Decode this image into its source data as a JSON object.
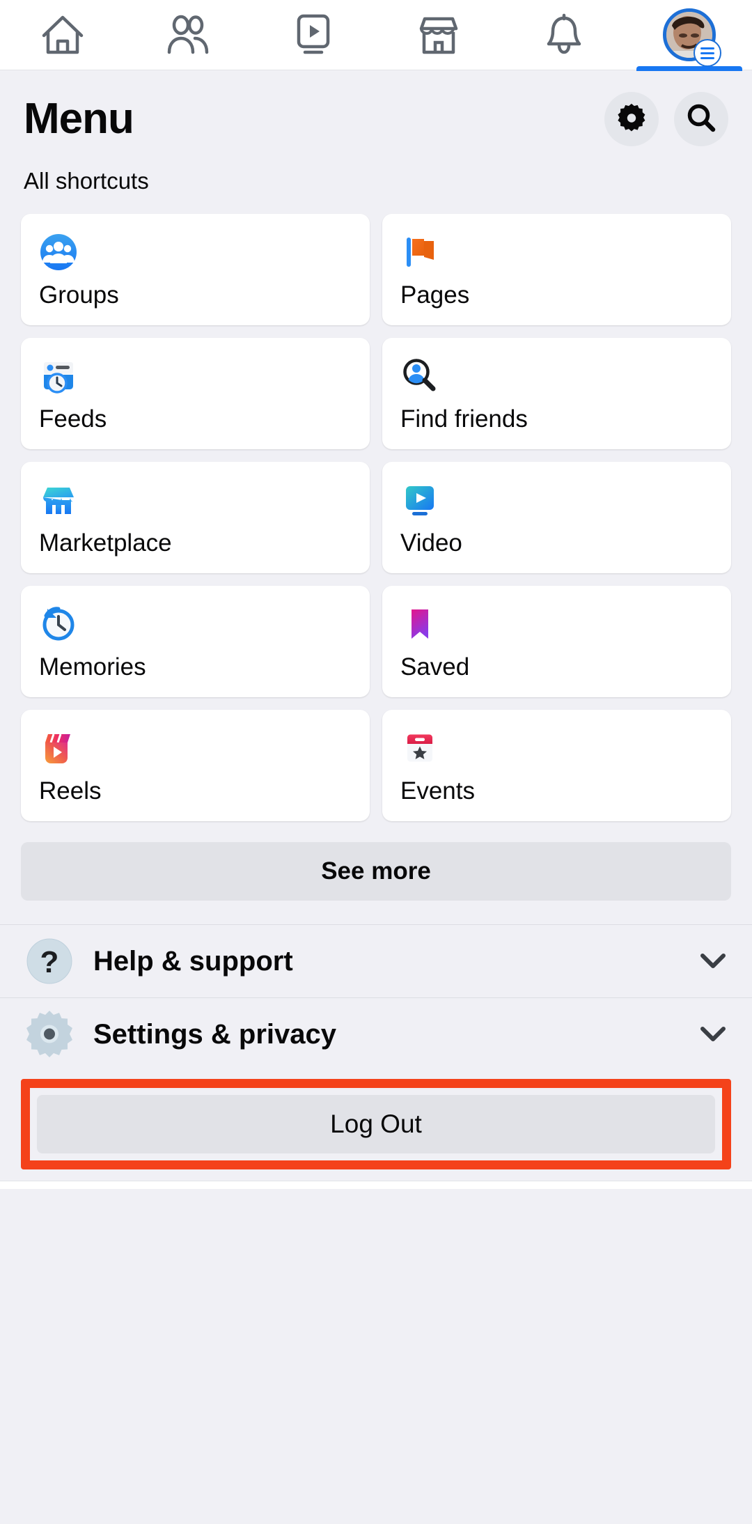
{
  "topnav": {
    "tabs": [
      {
        "name": "home",
        "icon": "home-icon",
        "active": false
      },
      {
        "name": "friends",
        "icon": "friends-icon",
        "active": false
      },
      {
        "name": "video",
        "icon": "video-icon",
        "active": false
      },
      {
        "name": "marketplace",
        "icon": "marketplace-icon",
        "active": false
      },
      {
        "name": "notifications",
        "icon": "bell-icon",
        "active": false
      },
      {
        "name": "menu-profile",
        "icon": "avatar-menu-icon",
        "active": true
      }
    ],
    "active_indicator_color": "#1877f2"
  },
  "header": {
    "title": "Menu",
    "settings_button": "gear-icon",
    "search_button": "search-icon"
  },
  "shortcuts": {
    "section_label": "All shortcuts",
    "items": [
      {
        "label": "Groups",
        "icon": "groups-icon"
      },
      {
        "label": "Pages",
        "icon": "pages-flag-icon"
      },
      {
        "label": "Feeds",
        "icon": "feeds-icon"
      },
      {
        "label": "Find friends",
        "icon": "find-friends-icon"
      },
      {
        "label": "Marketplace",
        "icon": "marketplace-store-icon"
      },
      {
        "label": "Video",
        "icon": "video-play-icon"
      },
      {
        "label": "Memories",
        "icon": "memories-clock-icon"
      },
      {
        "label": "Saved",
        "icon": "saved-bookmark-icon"
      },
      {
        "label": "Reels",
        "icon": "reels-icon"
      },
      {
        "label": "Events",
        "icon": "events-calendar-icon"
      }
    ],
    "see_more_label": "See more"
  },
  "expandable": [
    {
      "label": "Help & support",
      "icon": "question-mark-icon",
      "chevron": "chevron-down-icon"
    },
    {
      "label": "Settings & privacy",
      "icon": "gear-settings-icon",
      "chevron": "chevron-down-icon"
    }
  ],
  "logout": {
    "label": "Log Out",
    "highlight_color": "#f4421a"
  },
  "colors": {
    "page_background": "#f0f0f5",
    "card_background": "#ffffff",
    "button_gray": "#e1e2e7",
    "brand_blue": "#1877f2",
    "text_primary": "#080809"
  }
}
